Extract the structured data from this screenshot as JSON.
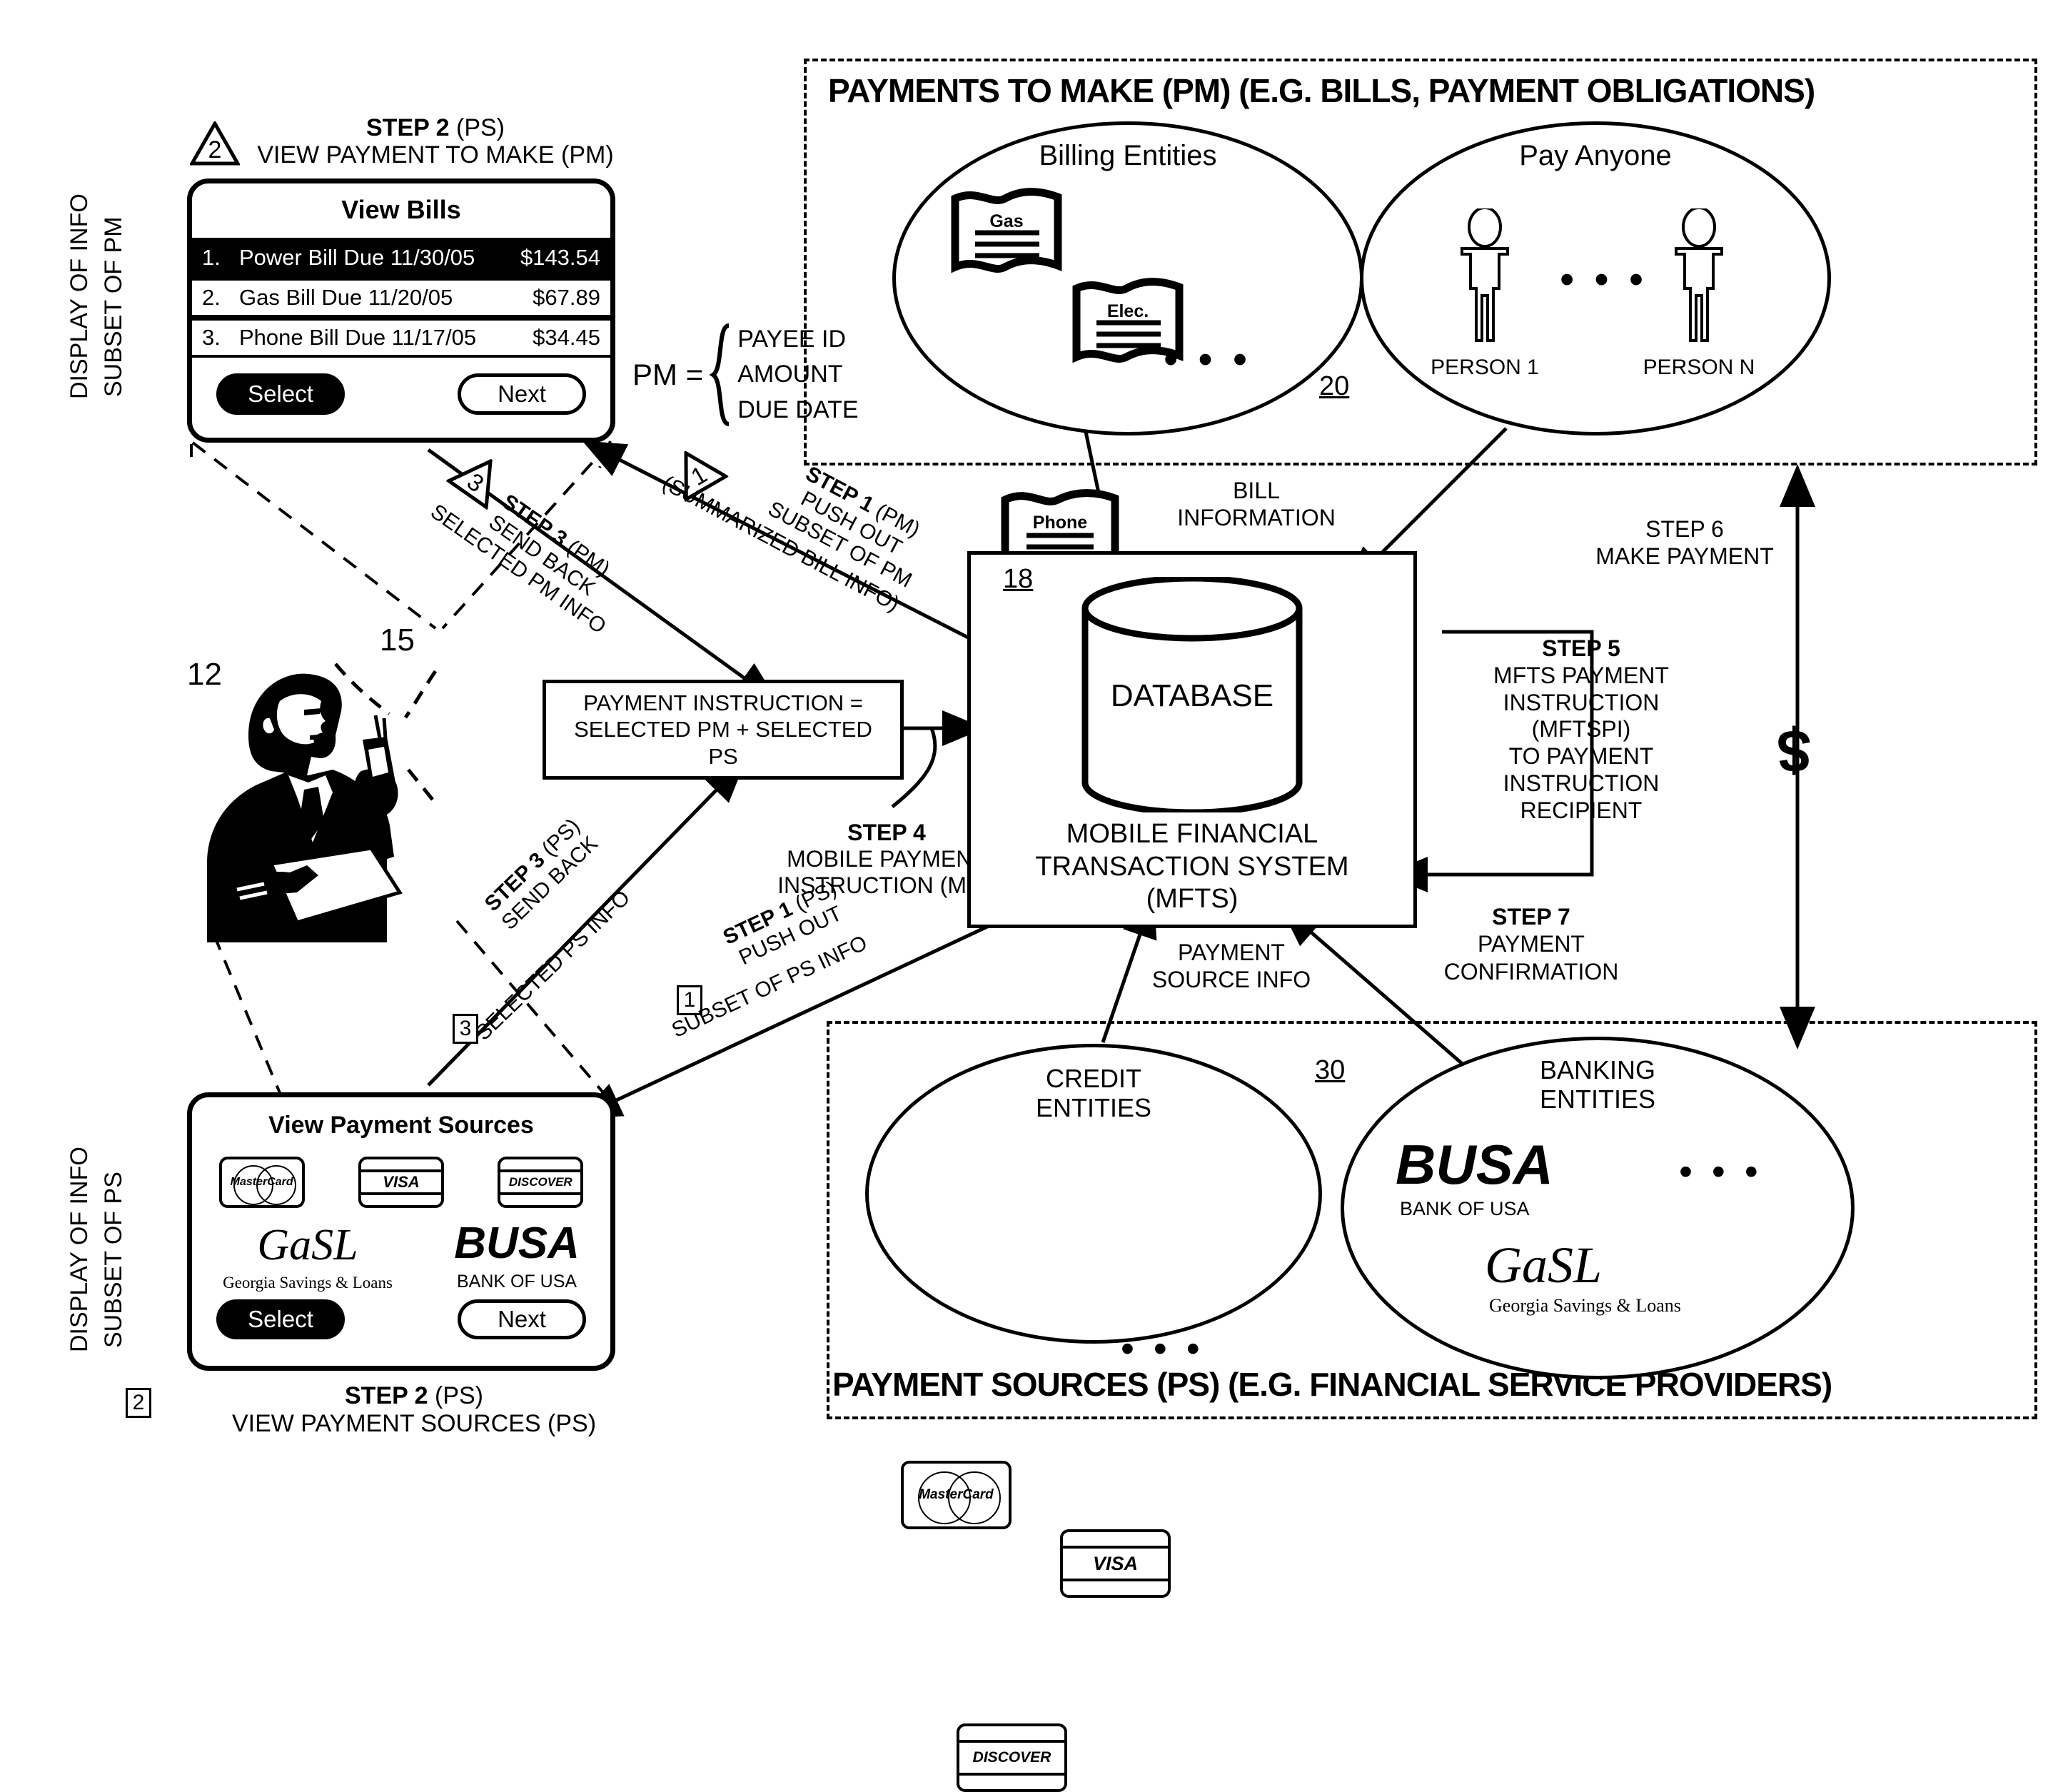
{
  "regions": {
    "pm": {
      "title": "PAYMENTS TO MAKE (PM) (E.G. BILLS, PAYMENT OBLIGATIONS)",
      "ref": "20",
      "billing_entities": {
        "label": "Billing Entities",
        "bills": [
          "Gas",
          "Elec.",
          "Phone"
        ],
        "ellipsis": "• • •"
      },
      "pay_anyone": {
        "label": "Pay Anyone",
        "persons": [
          "PERSON 1",
          "PERSON N"
        ],
        "ellipsis": "• • •"
      }
    },
    "ps": {
      "title": "PAYMENT SOURCES (PS) (E.G. FINANCIAL SERVICE PROVIDERS)",
      "ref": "30",
      "credit_entities": {
        "label_line1": "CREDIT",
        "label_line2": "ENTITIES",
        "cards": [
          "MasterCard",
          "VISA",
          "DISCOVER"
        ],
        "ellipsis": "• • •"
      },
      "banking_entities": {
        "label_line1": "BANKING",
        "label_line2": "ENTITIES",
        "banks": [
          {
            "logo": "BUSA",
            "name": "BANK OF USA"
          },
          {
            "logo": "GaSL",
            "name": "Georgia Savings & Loans"
          }
        ],
        "ellipsis": "• • •"
      }
    }
  },
  "side_labels": {
    "pm": "DISPLAY OF INFO\nSUBSET OF PM",
    "pm_line1": "DISPLAY OF INFO",
    "pm_line2": "SUBSET OF PM",
    "ps_line1": "DISPLAY OF INFO",
    "ps_line2": "SUBSET OF PS"
  },
  "view_bills": {
    "badge": "2",
    "step_bold": "STEP 2",
    "step_rest": " (PS)",
    "step_sub": "VIEW PAYMENT TO MAKE (PM)",
    "title": "View Bills",
    "rows": [
      {
        "index": "1.",
        "desc": "Power Bill Due 11/30/05",
        "amount": "$143.54",
        "selected": true
      },
      {
        "index": "2.",
        "desc": "Gas Bill Due 11/20/05",
        "amount": "$67.89",
        "selected": false
      },
      {
        "index": "3.",
        "desc": "Phone Bill Due 11/17/05",
        "amount": "$34.45",
        "selected": false
      }
    ],
    "select_button": "Select",
    "next_button": "Next"
  },
  "view_payment_sources": {
    "badge": "2",
    "title": "View Payment Sources",
    "cards": [
      "MasterCard",
      "VISA",
      "DISCOVER"
    ],
    "bank1_logo": "GaSL",
    "bank1_name": "Georgia Savings & Loans",
    "bank2_logo": "BUSA",
    "bank2_name": "BANK OF USA",
    "select_button": "Select",
    "next_button": "Next",
    "step_bold": "STEP 2",
    "step_rest": " (PS)",
    "step_sub": "VIEW PAYMENT SOURCES (PS)"
  },
  "pm_definition": {
    "label": "PM =",
    "items": [
      "PAYEE ID",
      "AMOUNT",
      "DUE DATE"
    ]
  },
  "mfts": {
    "ref": "18",
    "database": "DATABASE",
    "line1": "MOBILE FINANCIAL",
    "line2": "TRANSACTION SYSTEM",
    "line3": "(MFTS)"
  },
  "payment_instruction_box": {
    "line1": "PAYMENT INSTRUCTION =",
    "line2": "SELECTED PM + SELECTED",
    "line3": "PS"
  },
  "arrow_labels": {
    "step1_pm": {
      "badge": "1",
      "bold": "STEP 1",
      "rest": " (PM)",
      "l2": "PUSH OUT",
      "l3": "SUBSET OF PM",
      "l4": "(SUMMARIZED BILL INFO)"
    },
    "step3_pm": {
      "badge": "3",
      "bold": "STEP 3",
      "rest": " (PM)",
      "l2": "SEND BACK",
      "l3": "SELECTED PM INFO"
    },
    "step1_ps": {
      "badge": "1",
      "bold": "STEP 1",
      "rest": " (PS)",
      "l2": "PUSH OUT",
      "l3": "SUBSET OF PS INFO"
    },
    "step3_ps": {
      "badge": "3",
      "bold": "STEP 3",
      "rest": " (PS)",
      "l2": "SEND BACK",
      "l3": "SELECTED PS INFO"
    },
    "step4": {
      "bold": "STEP 4",
      "l2": "MOBILE PAYMENT",
      "l3": "INSTRUCTION (MPI)"
    },
    "step5": {
      "bold": "STEP 5",
      "lines": [
        "MFTS  PAYMENT",
        "INSTRUCTION",
        "(MFTSPI)",
        "TO PAYMENT",
        "INSTRUCTION",
        "RECIPIENT"
      ]
    },
    "step6": {
      "bold": "STEP 6",
      "l2": "MAKE  PAYMENT"
    },
    "step7": {
      "bold": "STEP 7",
      "l2": "PAYMENT",
      "l3": "CONFIRMATION"
    },
    "bill_information": {
      "l1": "BILL",
      "l2": "INFORMATION"
    },
    "payment_source_info": {
      "l1": "PAYMENT",
      "l2": "SOURCE INFO"
    }
  },
  "refs": {
    "user": "12",
    "phone": "15",
    "bottom_badge": "2"
  },
  "money_symbol": "$",
  "colors": {
    "ink": "#000000",
    "paper": "#ffffff"
  }
}
